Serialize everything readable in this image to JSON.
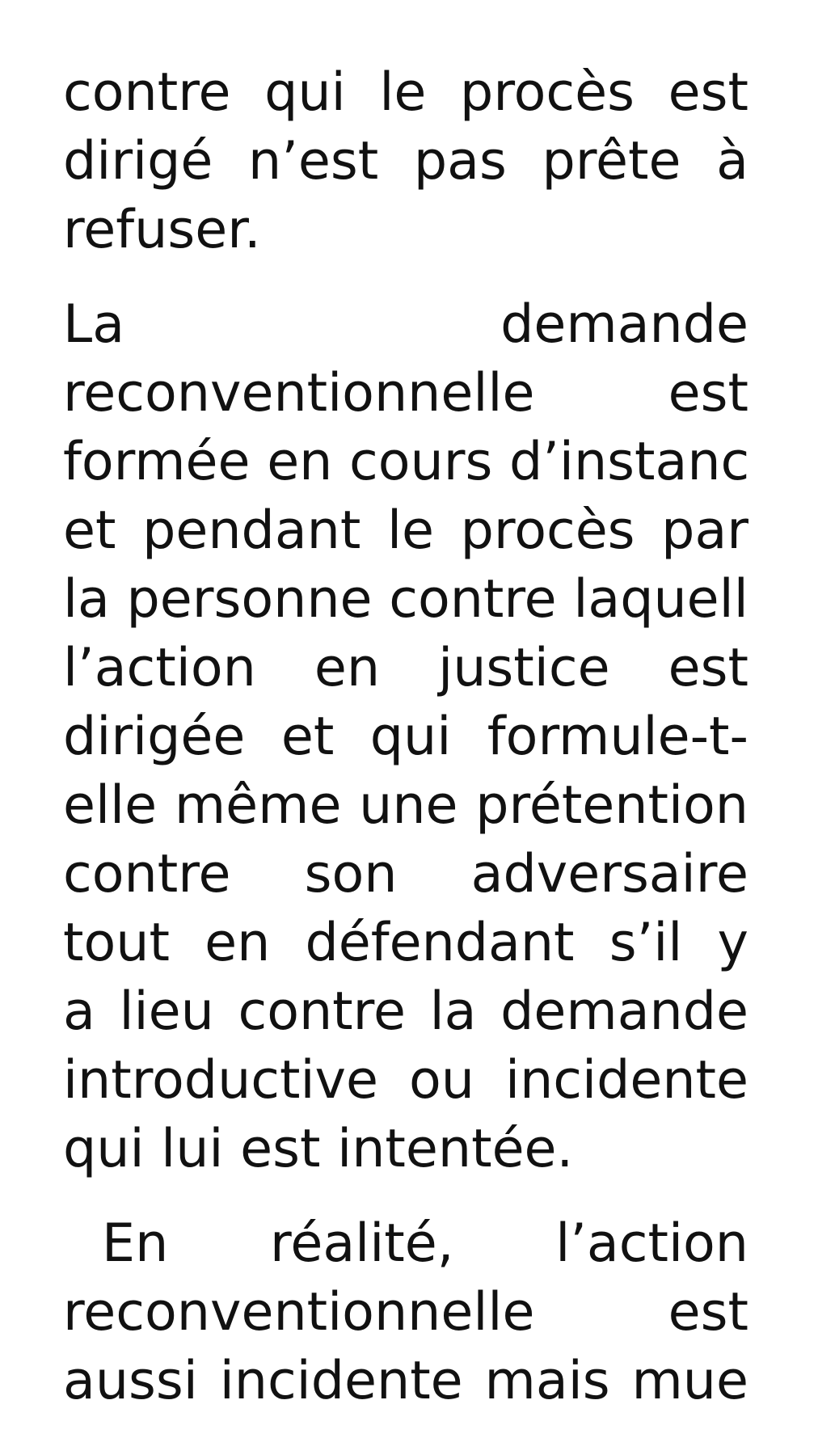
{
  "document": {
    "paragraphs": [
      {
        "lines": [
          "contre qui le procès est",
          "dirigé n’est pas prête à",
          "refuser."
        ]
      },
      {
        "lines": [
          "La demande",
          "reconventionnelle est",
          "formée en cours d’instance",
          "et pendant le procès par",
          "la personne contre laquelle",
          "l’action en justice est",
          "dirigée et qui formule-t-",
          "elle même une prétention",
          "contre son adversaire",
          "tout en défendant s’il y",
          "a lieu contre la demande",
          "introductive ou incidente",
          "qui lui est intentée."
        ]
      },
      {
        "lines": [
          "En réalité, l’action",
          "reconventionnelle est",
          "aussi incidente mais mue"
        ]
      }
    ]
  }
}
